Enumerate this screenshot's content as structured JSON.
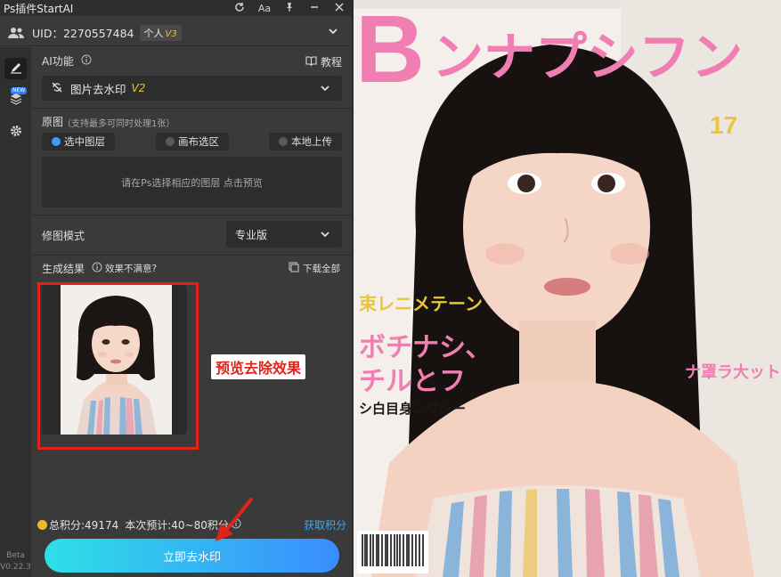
{
  "app": {
    "title": "Ps插件StartAI",
    "theme_color": "#3a3a3a",
    "accent_color": "#3b9bff"
  },
  "titlebar_icons": [
    "refresh-icon",
    "font-size-icon",
    "pin-icon",
    "minimize-icon",
    "close-icon"
  ],
  "font_size_label": "Aa",
  "user": {
    "uid_label": "UID：2270557484",
    "plan_label": "个人",
    "plan_version": "V3"
  },
  "sidebar": {
    "new_badge": "NEW",
    "beta_label": "Beta",
    "version": "V0.22.3"
  },
  "ai_function": {
    "label": "AI功能",
    "tutorial_label": "教程",
    "selected_tool": "图片去水印",
    "selected_tool_version": "V2"
  },
  "source": {
    "label": "原图",
    "hint": "（支持最多可同时处理1张）",
    "options": [
      "选中图层",
      "画布选区",
      "本地上传"
    ],
    "selected_option": "选中图层",
    "dropzone_text": "请在Ps选择相应的图层 点击预览"
  },
  "retouch": {
    "label": "修图模式",
    "selected_mode": "专业版"
  },
  "result": {
    "label": "生成结果",
    "feedback_label": "效果不满意?",
    "download_all_label": "下载全部",
    "annotation": "预览去除效果"
  },
  "footer": {
    "total_points_label": "总积分:49174",
    "estimate_label": "本次预计:40~80积分",
    "get_points_label": "获取积分",
    "go_button_label": "立即去水印"
  },
  "canvas": {
    "masthead_letter": "B",
    "masthead_text": "ンナプシフン",
    "cover_lines": [
      "ボチナシ、",
      "チルとフ",
      "束レニメテーン",
      "ナ罩ラ大ット",
      "シ白目身ンヴシー"
    ],
    "side_number": "17"
  }
}
